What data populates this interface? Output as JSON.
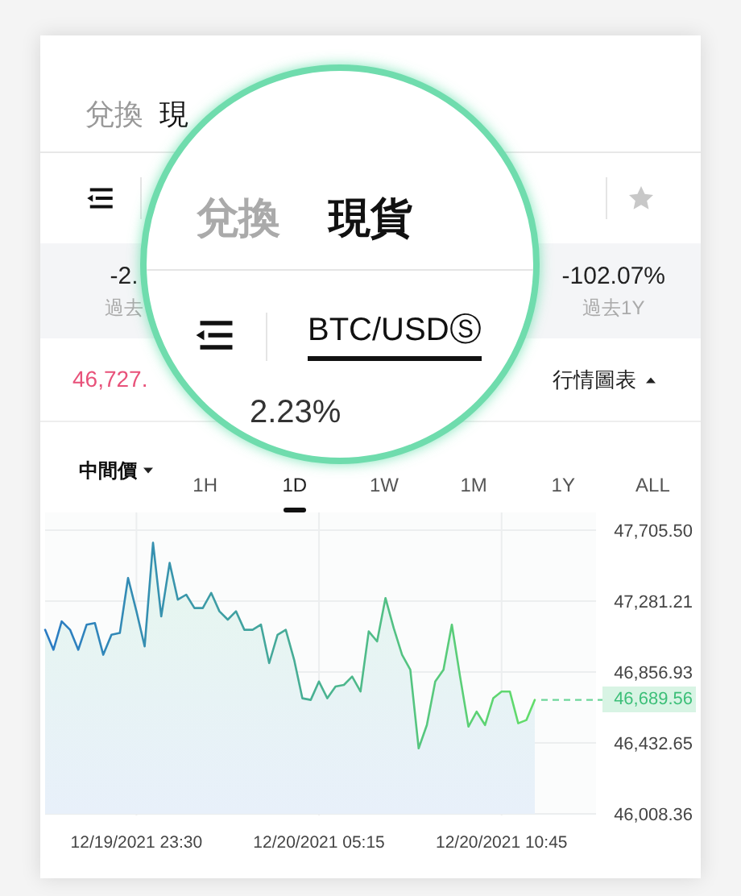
{
  "tabs": [
    {
      "label": "兌換",
      "selected": false
    },
    {
      "label": "現",
      "selected": true
    }
  ],
  "stats": [
    {
      "value": "-2.",
      "label": "過去"
    },
    {
      "value": "-102.07%",
      "label": "過去1Y"
    }
  ],
  "price": "46,727.",
  "chart_toggle": {
    "label": "行情圖表",
    "expanded": true
  },
  "price_type": {
    "label": "中間價"
  },
  "ranges": [
    {
      "label": "1H",
      "selected": false
    },
    {
      "label": "1D",
      "selected": true
    },
    {
      "label": "1W",
      "selected": false
    },
    {
      "label": "1M",
      "selected": false
    },
    {
      "label": "1Y",
      "selected": false
    },
    {
      "label": "ALL",
      "selected": false
    }
  ],
  "chart": {
    "current_price": "46,689.56",
    "chart_data": {
      "type": "area",
      "grid": true,
      "categories": [
        null,
        null,
        null,
        null,
        null,
        null,
        null,
        null,
        null,
        null,
        null,
        "12/19/2021 23:30",
        null,
        null,
        null,
        null,
        null,
        null,
        null,
        null,
        null,
        null,
        null,
        null,
        null,
        null,
        null,
        null,
        null,
        null,
        null,
        null,
        null,
        "12/20/2021 05:15",
        null,
        null,
        null,
        null,
        null,
        null,
        null,
        null,
        null,
        null,
        null,
        null,
        null,
        null,
        null,
        null,
        null,
        null,
        null,
        null,
        null,
        "12/20/2021 10:45",
        null,
        null,
        null,
        null
      ],
      "series": [
        {
          "values": [
            47110,
            46990,
            47160,
            47110,
            46990,
            47140,
            47150,
            46960,
            47080,
            47090,
            47420,
            47220,
            47010,
            47630,
            47190,
            47510,
            47290,
            47320,
            47240,
            47240,
            47330,
            47220,
            47170,
            47220,
            47110,
            47110,
            47140,
            46910,
            47080,
            47110,
            46930,
            46700,
            46690,
            46800,
            46700,
            46770,
            46780,
            46830,
            46740,
            47100,
            47040,
            47300,
            47120,
            46960,
            46870,
            46400,
            46540,
            46800,
            46870,
            47140,
            46830,
            46530,
            46620,
            46540,
            46700,
            46740,
            46740,
            46550,
            46570,
            46690
          ]
        }
      ],
      "ylim": [
        46008.36,
        47705.5
      ],
      "yticks": [
        {
          "value": 47705.5,
          "label": "47,705.50"
        },
        {
          "value": 47281.21,
          "label": "47,281.21"
        },
        {
          "value": 46856.93,
          "label": "46,856.93"
        },
        {
          "value": 46432.65,
          "label": "46,432.65"
        },
        {
          "value": 46008.36,
          "label": "46,008.36"
        }
      ]
    }
  },
  "magnifier": {
    "tabs": [
      {
        "label": "兌換",
        "selected": false
      },
      {
        "label": "現貨",
        "selected": true
      }
    ],
    "pair": "BTC/USDⓈ",
    "change": "2.23%"
  }
}
